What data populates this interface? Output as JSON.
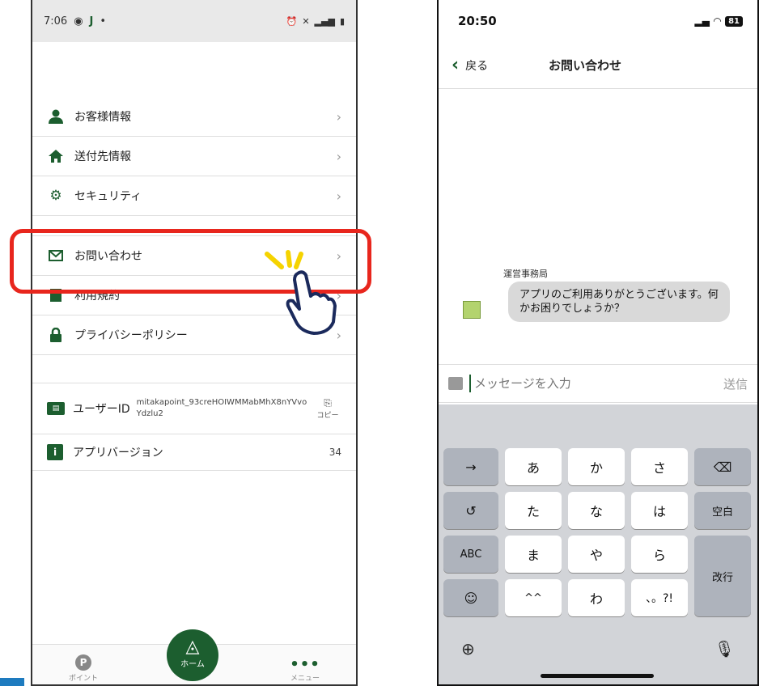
{
  "left_phone": {
    "status": {
      "time": "7:06",
      "carrier": "J"
    },
    "menu": [
      {
        "label": "お客様情報",
        "icon": "person-icon"
      },
      {
        "label": "送付先情報",
        "icon": "home-icon"
      },
      {
        "label": "セキュリティ",
        "icon": "gear-icon"
      },
      {
        "label": "お問い合わせ",
        "icon": "mail-icon"
      },
      {
        "label": "利用規約",
        "icon": "document-icon"
      },
      {
        "label": "プライバシーポリシー",
        "icon": "lock-icon"
      }
    ],
    "user_id_label": "ユーザーID",
    "user_id_value": "mitakapoint_93creHOIWMMabMhX8nYVvo Ydzlu2",
    "copy_label": "コピー",
    "version_label": "アプリバージョン",
    "version_value": "34",
    "nav": {
      "point": "ポイント",
      "home": "ホーム",
      "menu": "メニュー",
      "point_badge": "P"
    },
    "highlight_color": "#e8261d",
    "accent": "#1c5e2f"
  },
  "right_phone": {
    "status": {
      "time": "20:50",
      "battery": "81"
    },
    "back_label": "戻る",
    "title": "お問い合わせ",
    "sender": "運営事務局",
    "message": "アプリのご利用ありがとうございます。何かお困りでしょうか？",
    "input_placeholder": "メッセージを入力",
    "send_label": "送信",
    "keys": {
      "row1": [
        "→",
        "あ",
        "か",
        "さ",
        "⌫"
      ],
      "row2": [
        "↺",
        "た",
        "な",
        "は",
        "空白"
      ],
      "row3": [
        "ABC",
        "ま",
        "や",
        "ら"
      ],
      "row4": [
        "☺",
        "^^",
        "わ",
        "、。?!"
      ],
      "enter": "改行"
    }
  }
}
